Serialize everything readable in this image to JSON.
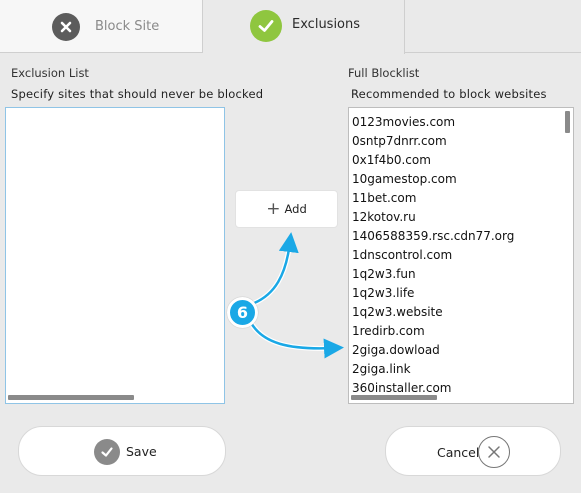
{
  "tabs": [
    {
      "label": "Block Site",
      "icon": "close-icon",
      "active": false
    },
    {
      "label": "Exclusions",
      "icon": "checkmark-icon",
      "active": true
    }
  ],
  "exclusion": {
    "title": "Exclusion List",
    "subtitle": "Specify sites that should never be blocked",
    "items": []
  },
  "blocklist": {
    "title": "Full Blocklist",
    "subtitle": "Recommended to block websites",
    "items": [
      "0123movies.com",
      "0sntp7dnrr.com",
      "0x1f4b0.com",
      "10gamestop.com",
      "11bet.com",
      "12kotov.ru",
      "1406588359.rsc.cdn77.org",
      "1dnscontrol.com",
      "1q2w3.fun",
      "1q2w3.life",
      "1q2w3.website",
      "1redirb.com",
      "2giga.dowload",
      "2giga.link",
      "360installer.com"
    ]
  },
  "add_button": {
    "label": "Add",
    "icon": "plus-icon"
  },
  "annotation": {
    "badge": "6"
  },
  "footer": {
    "save_label": "Save",
    "cancel_label": "Cancel"
  },
  "colors": {
    "accent_green": "#8fc63f",
    "annotation_blue": "#1aa8e6",
    "list_border": "#8fc4e6"
  }
}
